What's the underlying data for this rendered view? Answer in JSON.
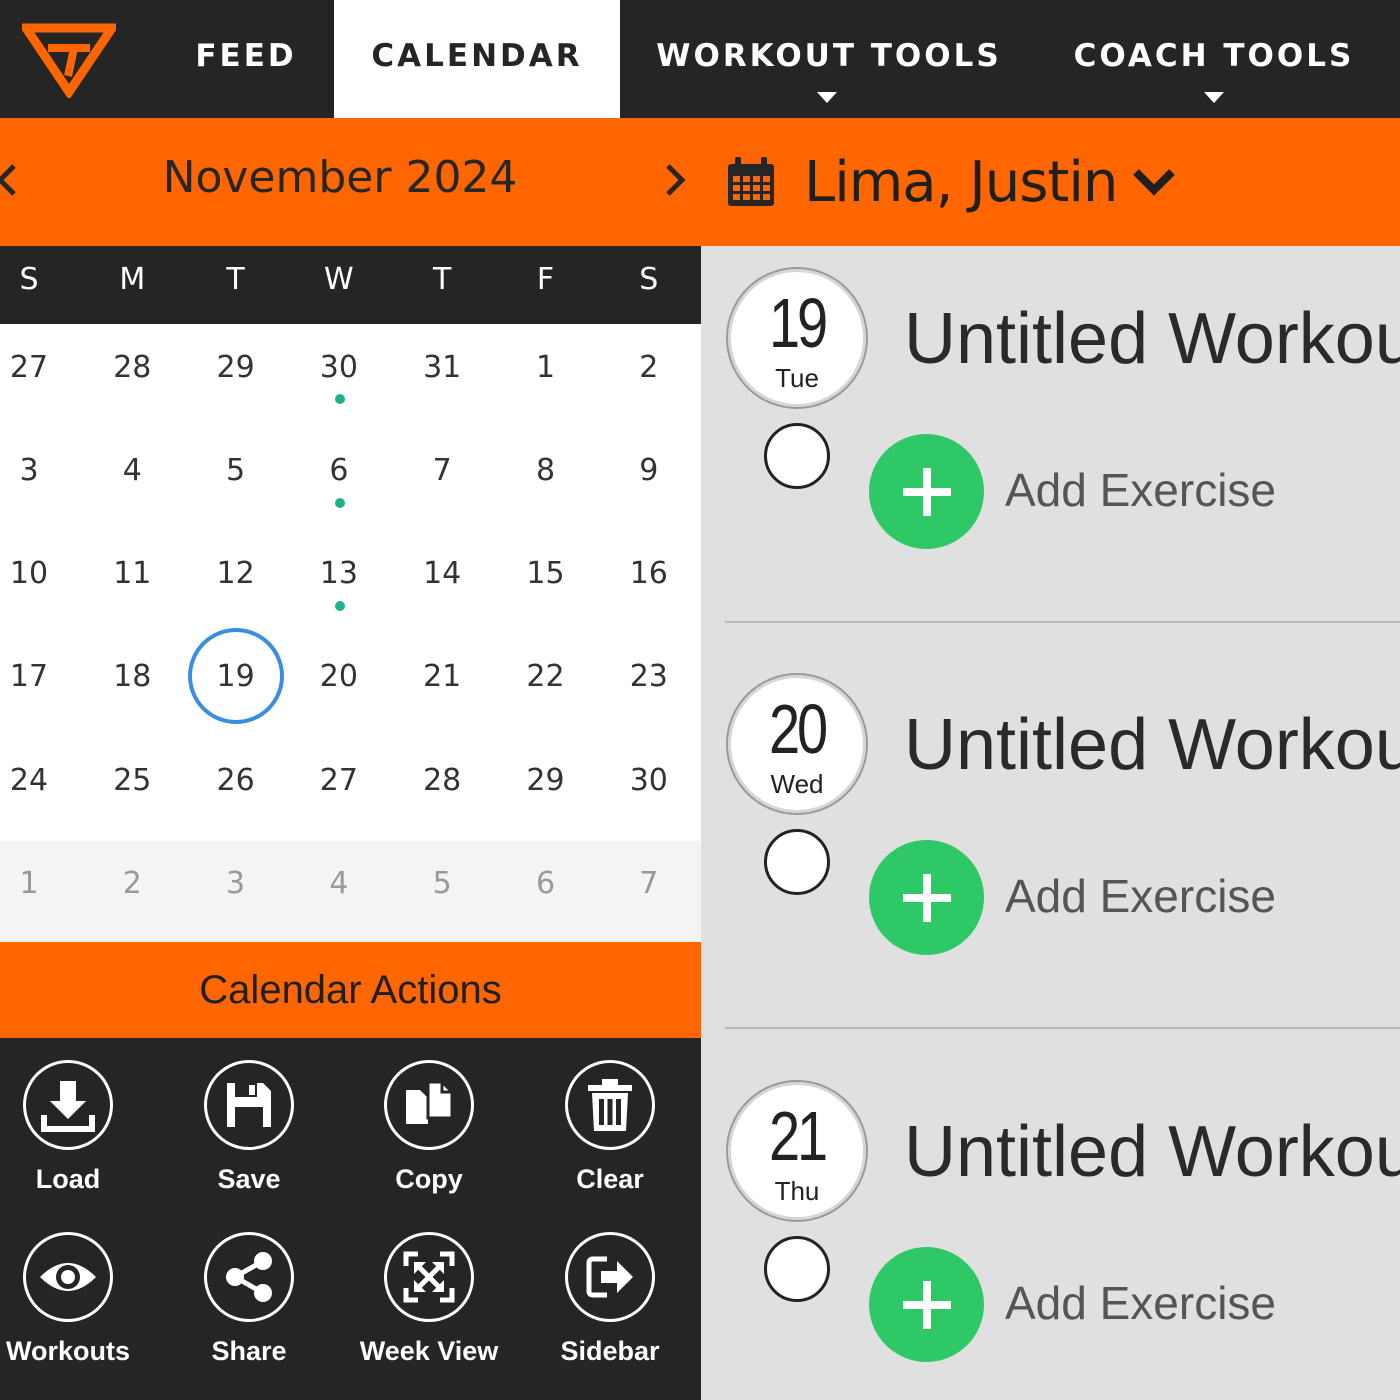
{
  "nav": {
    "tabs": [
      {
        "label": "FEED"
      },
      {
        "label": "CALENDAR"
      },
      {
        "label": "WORKOUT TOOLS"
      },
      {
        "label": "COACH TOOLS"
      }
    ],
    "active_tab": "CALENDAR"
  },
  "colors": {
    "accent": "#ff6600",
    "dark": "#252525",
    "dot": "#1fb28a",
    "selected": "#3a8ee0",
    "add": "#2ec866"
  },
  "header": {
    "month": "November 2024",
    "prev_icon": "chevron-left-icon",
    "next_icon": "chevron-right-icon",
    "athlete_name": "Lima, Justin"
  },
  "calendar": {
    "weekdays": [
      "S",
      "M",
      "T",
      "W",
      "T",
      "F",
      "S"
    ],
    "weeks": [
      [
        "27",
        "28",
        "29",
        "30",
        "31",
        "1",
        "2"
      ],
      [
        "3",
        "4",
        "5",
        "6",
        "7",
        "8",
        "9"
      ],
      [
        "10",
        "11",
        "12",
        "13",
        "14",
        "15",
        "16"
      ],
      [
        "17",
        "18",
        "19",
        "20",
        "21",
        "22",
        "23"
      ],
      [
        "24",
        "25",
        "26",
        "27",
        "28",
        "29",
        "30"
      ]
    ],
    "next_week": [
      "1",
      "2",
      "3",
      "4",
      "5",
      "6",
      "7"
    ],
    "selected_day": "19"
  },
  "actions": {
    "title": "Calendar Actions",
    "items": [
      {
        "label": "Load",
        "icon": "download-icon"
      },
      {
        "label": "Save",
        "icon": "floppy-disk-icon"
      },
      {
        "label": "Copy",
        "icon": "copy-icon"
      },
      {
        "label": "Clear",
        "icon": "trash-icon"
      },
      {
        "label": "Workouts",
        "icon": "eye-icon"
      },
      {
        "label": "Share",
        "icon": "share-icon"
      },
      {
        "label": "Week View",
        "icon": "expand-icon"
      },
      {
        "label": "Sidebar",
        "icon": "sign-out-icon"
      }
    ]
  },
  "workouts": [
    {
      "day": "19",
      "weekday": "Tue",
      "title": "Untitled Workout",
      "add_label": "Add Exercise"
    },
    {
      "day": "20",
      "weekday": "Wed",
      "title": "Untitled Workout",
      "add_label": "Add Exercise"
    },
    {
      "day": "21",
      "weekday": "Thu",
      "title": "Untitled Workout",
      "add_label": "Add Exercise"
    }
  ]
}
